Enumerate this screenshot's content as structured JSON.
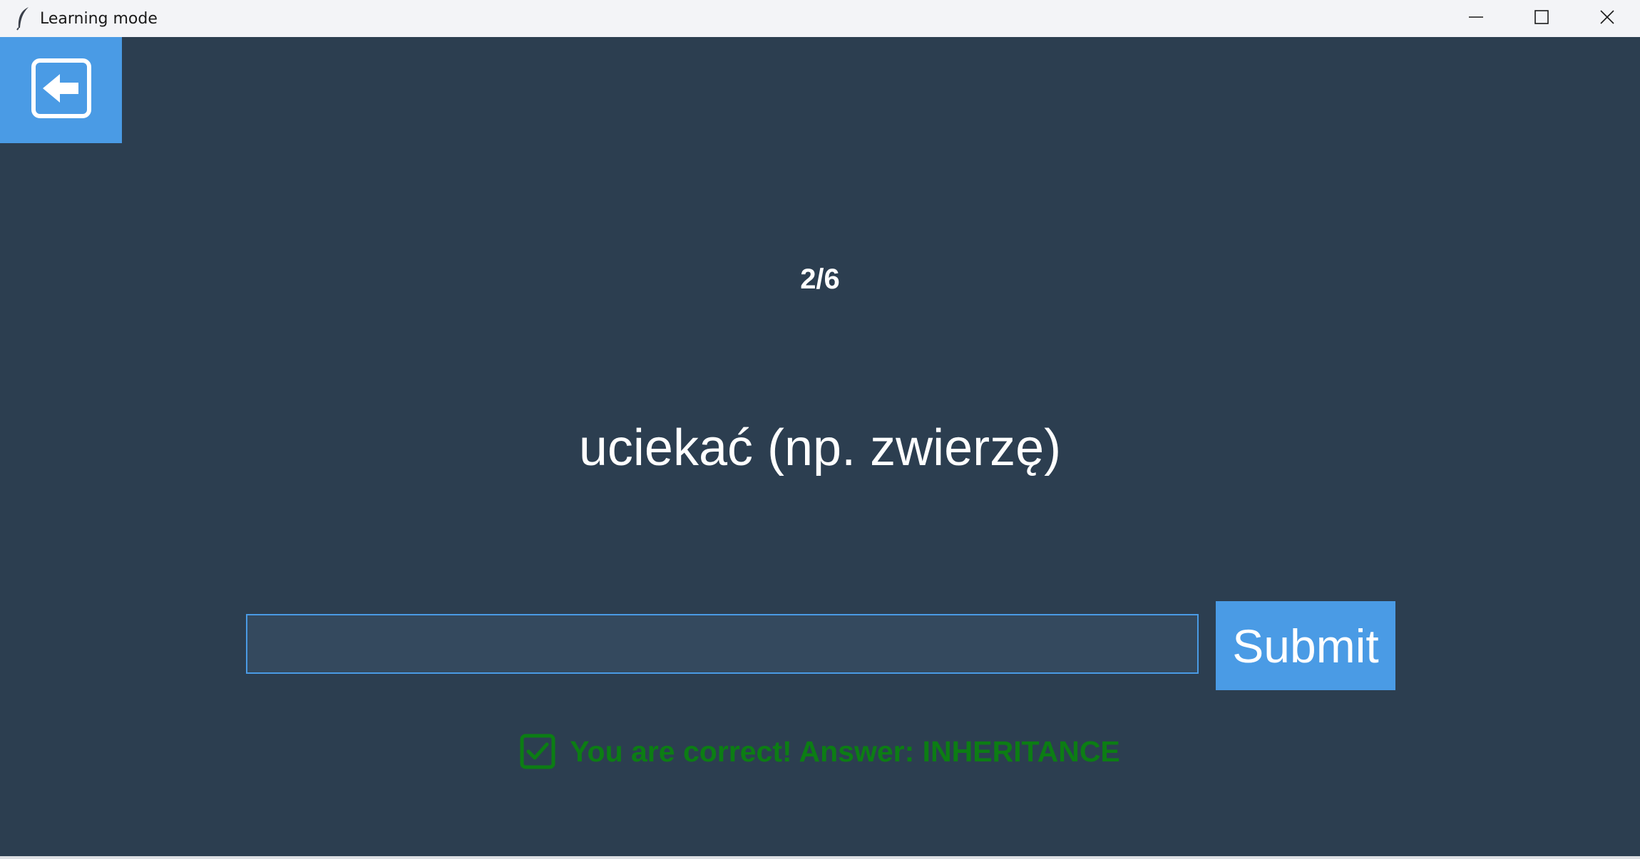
{
  "window": {
    "title": "Learning mode",
    "icons": {
      "app": "feather-icon",
      "minimize": "minimize-icon",
      "maximize": "maximize-icon",
      "close": "close-icon"
    }
  },
  "back_button": {
    "icon": "arrow-left-icon"
  },
  "quiz": {
    "progress": "2/6",
    "word": "uciekać (np. zwierzę)"
  },
  "answer_input": {
    "value": "",
    "placeholder": ""
  },
  "submit": {
    "label": "Submit"
  },
  "feedback": {
    "icon": "check-square-icon",
    "text": "You are correct! Answer: INHERITANCE"
  },
  "colors": {
    "background": "#2c3e50",
    "accent": "#4a9be5",
    "input_bg": "#34495e",
    "success": "#0c7d14",
    "text": "#ffffff"
  }
}
